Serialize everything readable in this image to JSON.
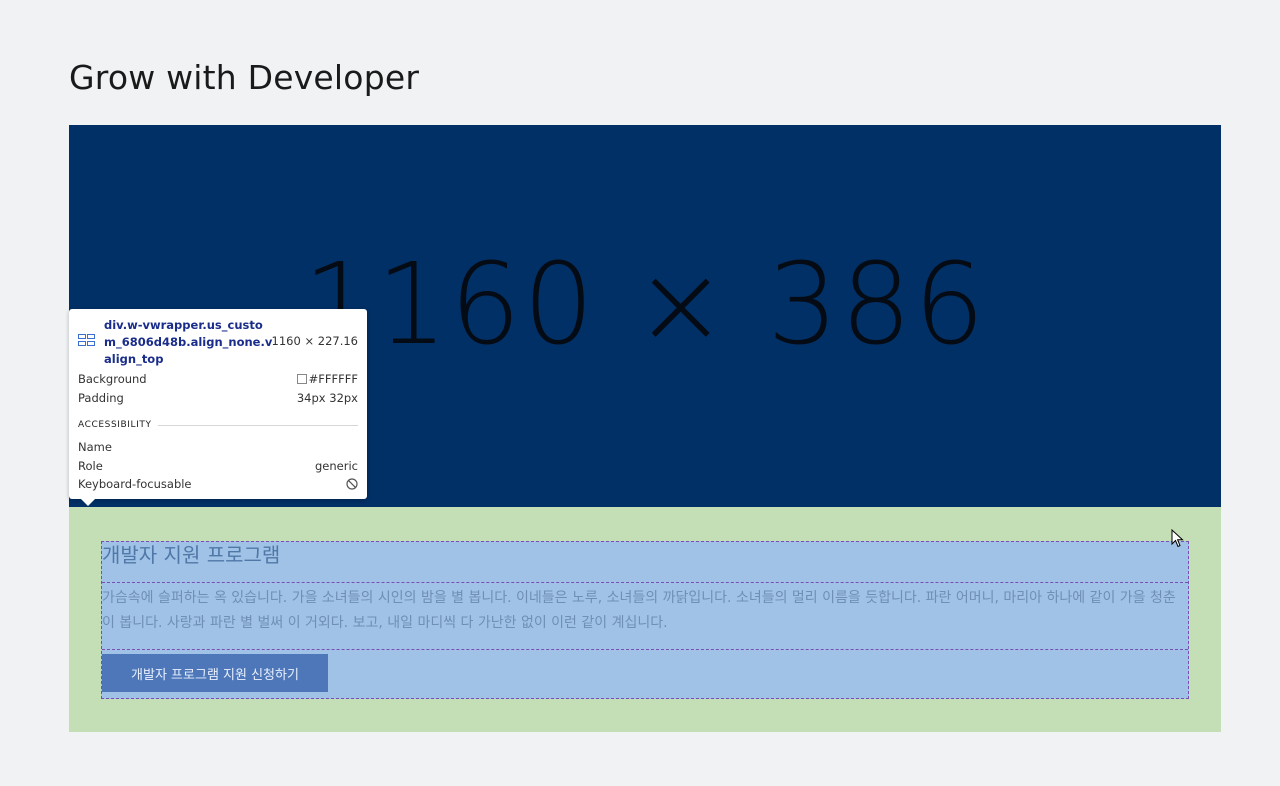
{
  "page": {
    "title": "Grow with Developer"
  },
  "placeholder": {
    "text": "1160 × 386",
    "background": "#003066"
  },
  "section": {
    "heading": "개발자 지원 프로그램",
    "body": "가슴속에 슬퍼하는 옥 있습니다. 가을 소녀들의 시인의 밤을 별 봅니다. 이네들은 노루, 소녀들의 까닭입니다. 소녀들의 멀리 이름을 듯합니다. 파란 어머니, 마리아 하나에 같이 가을 청춘이 봅니다. 사랑과 파란 별 벌써 이 거외다. 보고, 내일 마디씩 다 가난한 없이 이런 같이 계십니다.",
    "button_label": "개발자 프로그램 지원 신청하기",
    "wrapper_bg": "#c4deb5",
    "content_bg": "#a0c2e6",
    "button_bg": "#4d77b9"
  },
  "inspector": {
    "selector": "div.w-vwrapper.us_custom_6806d48b.align_none.valign_top",
    "size": "1160 × 227.16",
    "background_label": "Background",
    "background_value": "#FFFFFF",
    "padding_label": "Padding",
    "padding_value": "34px 32px",
    "accessibility_label": "ACCESSIBILITY",
    "name_label": "Name",
    "name_value": "",
    "role_label": "Role",
    "role_value": "generic",
    "focusable_label": "Keyboard-focusable",
    "focusable_icon": "not-allowed-icon"
  }
}
